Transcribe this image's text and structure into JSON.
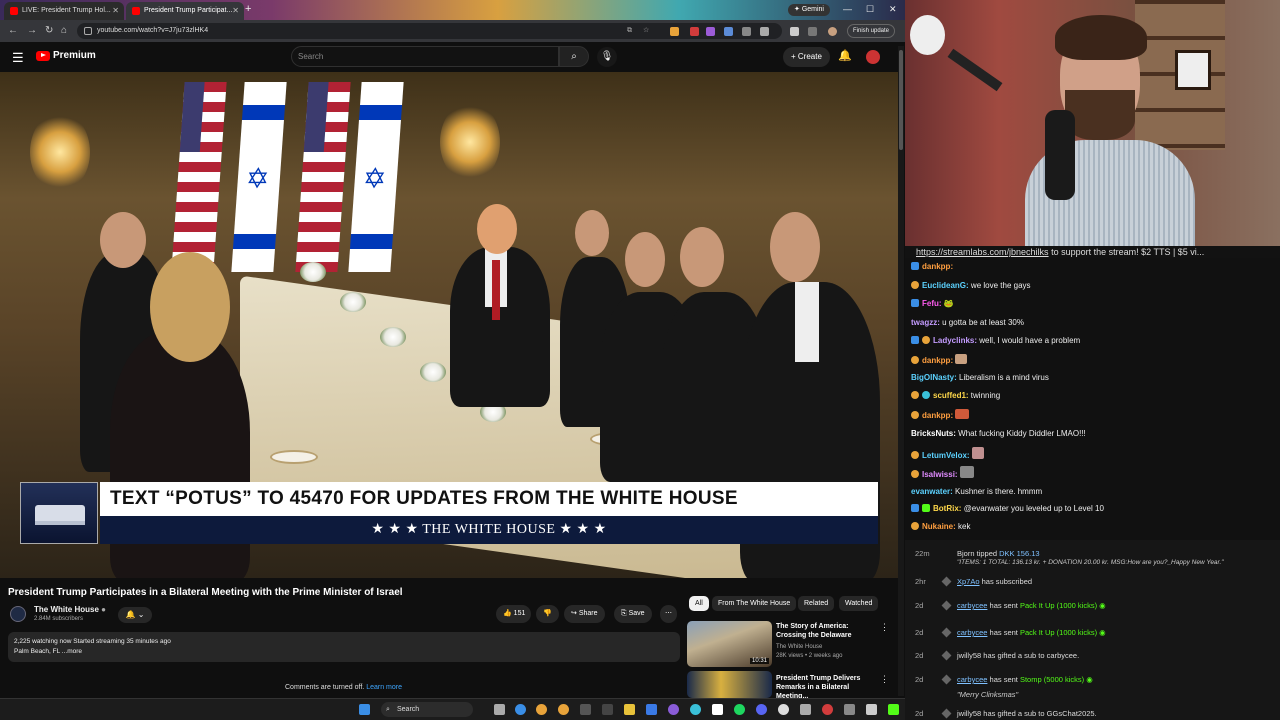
{
  "browser": {
    "tabs": [
      {
        "label": "LIVE: President Trump Hol..."
      },
      {
        "label": "President Trump Participat..."
      }
    ],
    "gemini_label": "Gemini",
    "url": "youtube.com/watch?v=J7ju73zlHK4",
    "finish_update": "Finish update"
  },
  "youtube": {
    "logo": "Premium",
    "search_placeholder": "Search",
    "create_label": "Create"
  },
  "video": {
    "lower_third": "TEXT “POTUS” TO 45470 FOR UPDATES FROM THE WHITE HOUSE",
    "lower_third_sub": "★ ★ ★  THE WHITE HOUSE  ★ ★ ★",
    "title": "President Trump Participates in a Bilateral Meeting with the Prime Minister of Israel",
    "channel": "The White House",
    "subscribers": "2.84M subscribers",
    "likes": "151",
    "share": "Share",
    "save": "Save",
    "watching": "2,225 watching now  Started streaming 35 minutes ago",
    "location": "Palm Beach, FL  ...more",
    "comments_off": "Comments are turned off.",
    "learn_more": "Learn more"
  },
  "chips": [
    "All",
    "From The White House",
    "Related",
    "Watched"
  ],
  "recommendations": [
    {
      "title": "The Story of America: Crossing the Delaware",
      "channel": "The White House",
      "meta": "28K views • 2 weeks ago",
      "duration": "10:31"
    },
    {
      "title": "President Trump Delivers Remarks in a Bilateral Meeting...",
      "channel": "",
      "meta": "",
      "duration": ""
    }
  ],
  "stream": {
    "banner_link": "https://streamlabs.com/jbnechilks",
    "banner_text": " to support the stream! $2 TTS | $5 vi..."
  },
  "chat": [
    {
      "user": "dankpp:",
      "text": "",
      "color": "#ff9f40"
    },
    {
      "user": "EuclideanG:",
      "text": "we love the gays",
      "color": "#5cd2ff"
    },
    {
      "user": "Fefu:",
      "text": "",
      "color": "#ff5cf0"
    },
    {
      "user": "twagzz:",
      "text": "u gotta be at least 30%",
      "color": "#c49cff"
    },
    {
      "user": "Ladyclinks:",
      "text": "well, I would have a problem",
      "color": "#c49cff"
    },
    {
      "user": "dankpp:",
      "text": "",
      "color": "#ff9f40"
    },
    {
      "user": "BigOlNasty:",
      "text": "Liberalism is a mind virus",
      "color": "#5cd2ff"
    },
    {
      "user": "scuffed1:",
      "text": "twinning",
      "color": "#ffd84a"
    },
    {
      "user": "dankpp:",
      "text": "",
      "color": "#ff9f40"
    },
    {
      "user": "BricksNuts:",
      "text": "What fucking Kiddy Diddler LMAO!!!",
      "color": "#ffffff"
    },
    {
      "user": "LetumVelox:",
      "text": "",
      "color": "#5cd2ff"
    },
    {
      "user": "Isalwissi:",
      "text": "",
      "color": "#e08cff"
    },
    {
      "user": "evanwater:",
      "text": "Kushner is there. hmmm",
      "color": "#5cd2ff"
    },
    {
      "user": "BotRix:",
      "text": "@evanwater you leveled up to Level 10",
      "color": "#ffd84a"
    },
    {
      "user": "Nukaine:",
      "text": "kek",
      "color": "#ff9f40"
    }
  ],
  "events": [
    {
      "time": "22m",
      "name": "Bjorn",
      "action": " tipped ",
      "amount": "DKK 156.13",
      "note": "\"ITEMS: 1 TOTAL: 136.13 kr. + DONATION 20.00 kr. MSG:How are you?_Happy New Year.\""
    },
    {
      "time": "2hr",
      "name": "Xp7Ao",
      "action": " has subscribed",
      "amount": "",
      "note": ""
    },
    {
      "time": "2d",
      "name": "carbycee",
      "action": " has sent ",
      "amount": "Pack It Up (1000 kicks)",
      "note": ""
    },
    {
      "time": "2d",
      "name": "carbycee",
      "action": " has sent ",
      "amount": "Pack It Up (1000 kicks)",
      "note": ""
    },
    {
      "time": "2d",
      "name": "jwilly58",
      "action": " has gifted a sub to ",
      "amount": "carbycee.",
      "note": ""
    },
    {
      "time": "2d",
      "name": "carbycee",
      "action": " has sent ",
      "amount": "Stomp (5000 kicks)",
      "note": "\"Merry Clinksmas\""
    },
    {
      "time": "2d",
      "name": "jwilly58",
      "action": " has gifted a sub to ",
      "amount": "GGsChat2025.",
      "note": ""
    }
  ],
  "taskbar": {
    "search": "Search"
  }
}
